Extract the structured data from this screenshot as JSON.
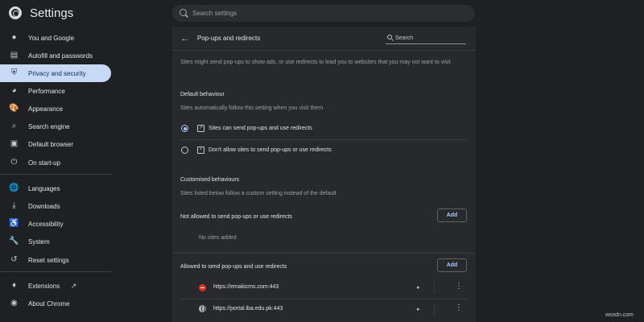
{
  "app": {
    "title": "Settings"
  },
  "search": {
    "placeholder": "Search settings"
  },
  "sidebar": {
    "items": [
      {
        "label": "You and Google",
        "icon": "person-icon"
      },
      {
        "label": "Autofill and passwords",
        "icon": "clipboard-icon"
      },
      {
        "label": "Privacy and security",
        "icon": "shield-icon",
        "active": true
      },
      {
        "label": "Performance",
        "icon": "speedometer-icon"
      },
      {
        "label": "Appearance",
        "icon": "palette-icon"
      },
      {
        "label": "Search engine",
        "icon": "search-icon"
      },
      {
        "label": "Default browser",
        "icon": "browser-icon"
      },
      {
        "label": "On start-up",
        "icon": "power-icon"
      },
      {
        "label": "Languages",
        "icon": "globe-icon"
      },
      {
        "label": "Downloads",
        "icon": "download-icon"
      },
      {
        "label": "Accessibility",
        "icon": "accessibility-icon"
      },
      {
        "label": "System",
        "icon": "wrench-icon"
      },
      {
        "label": "Reset settings",
        "icon": "reset-icon"
      },
      {
        "label": "Extensions",
        "icon": "puzzle-icon"
      },
      {
        "label": "About Chrome",
        "icon": "chrome-icon"
      }
    ]
  },
  "panel": {
    "title": "Pop-ups and redirects",
    "search_placeholder": "Search",
    "description": "Sites might send pop-ups to show ads, or use redirects to lead you to websites that you may not want to visit",
    "default_behaviour": {
      "heading": "Default behaviour",
      "subtitle": "Sites automatically follow this setting when you visit them",
      "options": [
        {
          "label": "Sites can send pop-ups and use redirects",
          "selected": true
        },
        {
          "label": "Don't allow sites to send pop-ups or use redirects",
          "selected": false
        }
      ]
    },
    "customised": {
      "heading": "Customised behaviours",
      "subtitle": "Sites listed below follow a custom setting instead of the default",
      "not_allowed": {
        "label": "Not allowed to send pop-ups or use redirects",
        "add_label": "Add",
        "empty_text": "No sites added"
      },
      "allowed": {
        "label": "Allowed to send pop-ups and use redirects",
        "add_label": "Add",
        "sites": [
          {
            "url": "https://emakicms.com:443",
            "icon": "red-site-icon"
          },
          {
            "url": "https://portal.iba.edu.pk:443",
            "icon": "globe-site-icon"
          }
        ]
      }
    }
  },
  "watermark": "wsxdn.com",
  "colors": {
    "background": "#1f2023",
    "panel": "#28292c",
    "accent": "#a8c7fa",
    "active_nav": "#c8d9f6"
  }
}
